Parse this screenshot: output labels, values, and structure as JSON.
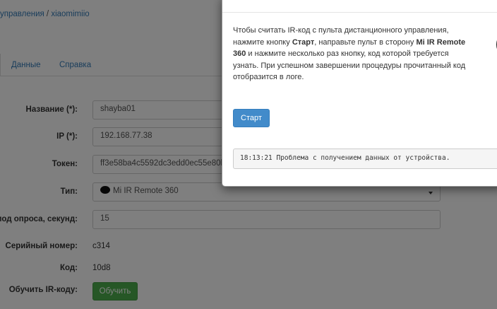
{
  "breadcrumb": {
    "part1": "управления",
    "separator": " / ",
    "part2": "xiaomimiio"
  },
  "tabs": [
    {
      "label": "Данные"
    },
    {
      "label": "Справка"
    }
  ],
  "form": {
    "name_label": "Название (*):",
    "name_value": "shayba01",
    "ip_label": "IP (*):",
    "ip_value": "192.168.77.38",
    "token_label": "Токен:",
    "token_value": "ff3e58ba4c5592dc3edd0ec55e80b",
    "type_label": "Тип:",
    "type_value": "Mi IR Remote 360",
    "poll_label": "иод опроса, секунд:",
    "poll_value": "15",
    "serial_label": "Серийный номер:",
    "serial_value": "c314",
    "code_label": "Код:",
    "code_value": "10d8",
    "learn_label": "Обучить IR-коду:",
    "learn_button": "Обучить"
  },
  "modal": {
    "title": "",
    "text_1": "Чтобы считать IR-код с пульта дистанционного управления, нажмите кнопку ",
    "text_start": "Старт",
    "text_2": ", направьте пульт в сторону ",
    "text_device": "Mi IR Remote 360",
    "text_3": " и нажмите несколько раз кнопку, код которой требуется узнать. При успешном завершении процедуры прочитанный код отобразится в логе.",
    "start_button": "Старт",
    "log_text": "18:13:21 Проблема с получением данных от устройства."
  },
  "colors": {
    "link": "#337ab7",
    "primary": "#428bca",
    "success": "#4cae4c",
    "overlay": "rgba(0,0,0,0.5)"
  },
  "icons": {
    "device_icon": "round-device-icon",
    "select_caret": "caret-down-icon",
    "illustration": "remote-illustration-icon"
  }
}
